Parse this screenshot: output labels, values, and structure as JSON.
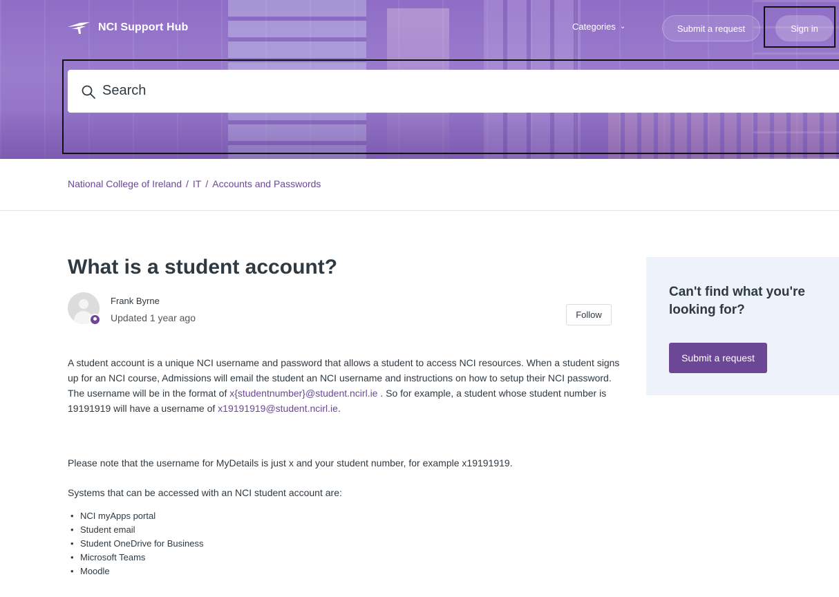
{
  "header": {
    "brand": "NCI Support Hub",
    "nav": {
      "categories": "Categories",
      "submit_request": "Submit a request",
      "sign_in": "Sign in"
    },
    "search": {
      "placeholder": "Search"
    }
  },
  "breadcrumb": [
    "National College of Ireland",
    "IT",
    "Accounts and Passwords"
  ],
  "breadcrumb_separator": "/",
  "article": {
    "title": "What is a student account?",
    "author": "Frank Byrne",
    "updated": "Updated 1 year ago",
    "follow": "Follow",
    "p1_a": "A student account is a unique NCI username and password that allows a student to access NCI resources. When a student signs up for an NCI course, Admissions will email the student an NCI username and instructions on how to setup their NCI password. The username will be in the format of ",
    "p1_link1": "x{studentnumber}@student.ncirl.ie",
    "p1_b": " . So for example, a student whose student number is 19191919 will have a username of ",
    "p1_link2": "x19191919@student.ncirl.ie",
    "p1_c": ".",
    "p2": "Please note that the username for MyDetails is just x and your student number, for example x19191919.",
    "p3": "Systems that can be accessed with an NCI student account are:",
    "systems": [
      "NCI myApps portal",
      "Student email",
      "Student OneDrive for Business",
      "Microsoft Teams",
      "Moodle"
    ]
  },
  "sidebar": {
    "title": "Can't find what you're looking for?",
    "button": "Submit a request"
  },
  "colors": {
    "accent": "#6b4796",
    "sidebar_bg": "#eef3fb"
  }
}
